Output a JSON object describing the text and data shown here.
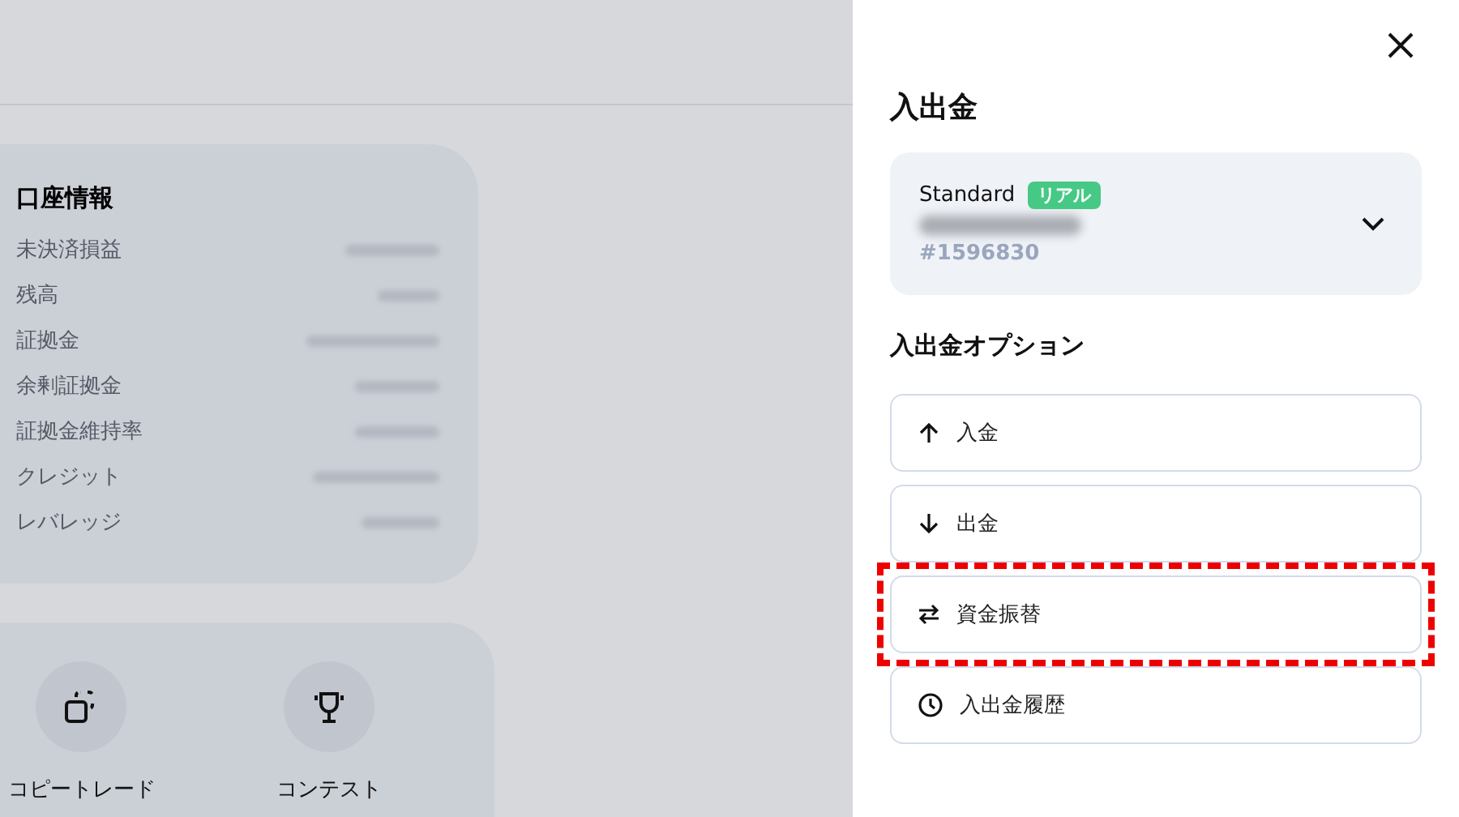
{
  "account_info": {
    "title": "口座情報",
    "rows": [
      {
        "label": "未決済損益"
      },
      {
        "label": "残高"
      },
      {
        "label": "証拠金"
      },
      {
        "label": "余剰証拠金"
      },
      {
        "label": "証拠金維持率"
      },
      {
        "label": "クレジット"
      },
      {
        "label": "レバレッジ"
      }
    ]
  },
  "shortcuts": [
    {
      "kind": "copy",
      "label": "コピートレード"
    },
    {
      "kind": "trophy",
      "label": "コンテスト"
    }
  ],
  "panel": {
    "title": "入出金",
    "account": {
      "type": "Standard",
      "badge": "リアル",
      "number": "#1596830"
    },
    "options_heading": "入出金オプション",
    "options": [
      {
        "kind": "up",
        "label": "入金",
        "highlighted": false
      },
      {
        "kind": "down",
        "label": "出金",
        "highlighted": false
      },
      {
        "kind": "swap",
        "label": "資金振替",
        "highlighted": true
      },
      {
        "kind": "clock",
        "label": "入出金履歴",
        "highlighted": false
      }
    ]
  }
}
